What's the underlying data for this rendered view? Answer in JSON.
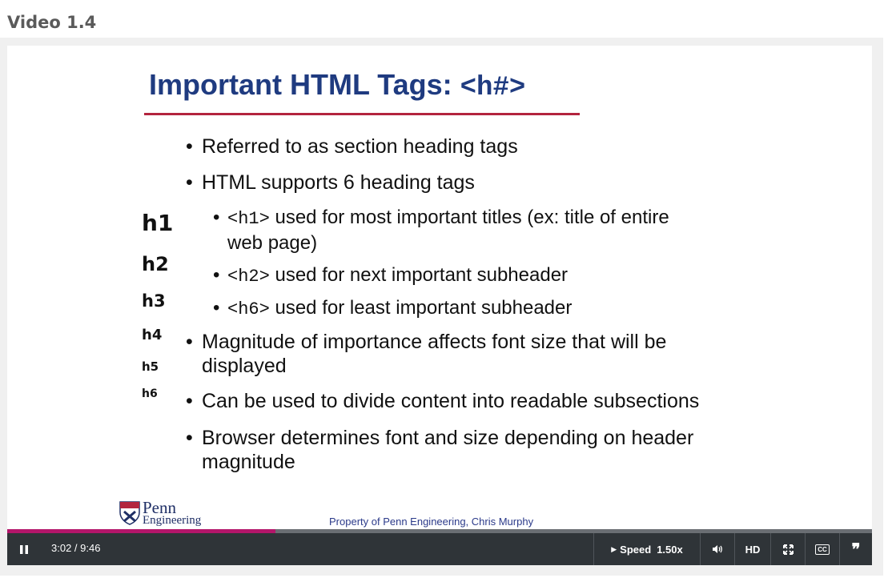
{
  "page": {
    "heading": "Video 1.4"
  },
  "slide": {
    "title_text": "Important HTML Tags: ",
    "title_code": "<h#>",
    "bullets": [
      {
        "text": "Referred to as section heading tags"
      },
      {
        "text": "HTML supports 6 heading tags"
      },
      {
        "code": "<h1>",
        "line1": " used for most important titles (ex: title of entire",
        "line2": "web page)"
      },
      {
        "code": "<h2>",
        "text": " used for next important subheader"
      },
      {
        "code": "<h6>",
        "text": " used for least important subheader"
      },
      {
        "line1": "Magnitude of importance affects font size that will be",
        "line2": "displayed"
      },
      {
        "text": "Can be used to divide content into readable subsections"
      },
      {
        "line1": "Browser determines font and size depending on header",
        "line2": "magnitude"
      }
    ],
    "heading_samples": [
      "h1",
      "h2",
      "h3",
      "h4",
      "h5",
      "h6"
    ],
    "logo": {
      "name": "Penn",
      "subtitle": "Engineering"
    },
    "copyright": "Property of Penn Engineering, Chris Murphy"
  },
  "player": {
    "current_time": "3:02",
    "duration": "9:46",
    "progress_fraction": 0.31,
    "speed_label": "Speed",
    "speed_value": "1.50x",
    "hd_label": "HD",
    "cc_label": "CC",
    "icons": [
      "pause-icon",
      "volume-icon",
      "fullscreen-icon",
      "closed-captions-icon",
      "transcript-quote-icon"
    ]
  },
  "colors": {
    "title_blue": "#1f3b80",
    "rule_red": "#b3243e",
    "progress_magenta": "#b4166a",
    "control_bar": "#2f3438"
  }
}
